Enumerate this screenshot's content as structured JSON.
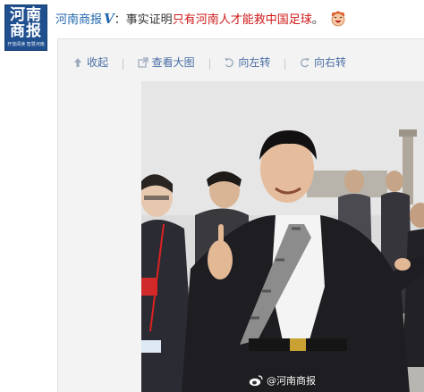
{
  "account": {
    "logo_line1": "河南",
    "logo_line2": "商报",
    "logo_sub": "开放阅读 智慧河南"
  },
  "post": {
    "author": "河南商报",
    "verified_mark": "V",
    "colon": "：",
    "text_plain": "事实证明",
    "text_highlight": "只有河南人才能救中国足球",
    "text_end": "。",
    "emoji": "laughing-face-icon"
  },
  "toolbar": {
    "collapse": "收起",
    "view_large": "查看大图",
    "rotate_left": "向左转",
    "rotate_right": "向右转"
  },
  "photo": {
    "watermark": "@河南商报"
  },
  "colors": {
    "link": "#1f66ad",
    "highlight": "#d01818",
    "logo_bg": "#1f4f8f",
    "toolbar": "#496ea5"
  }
}
